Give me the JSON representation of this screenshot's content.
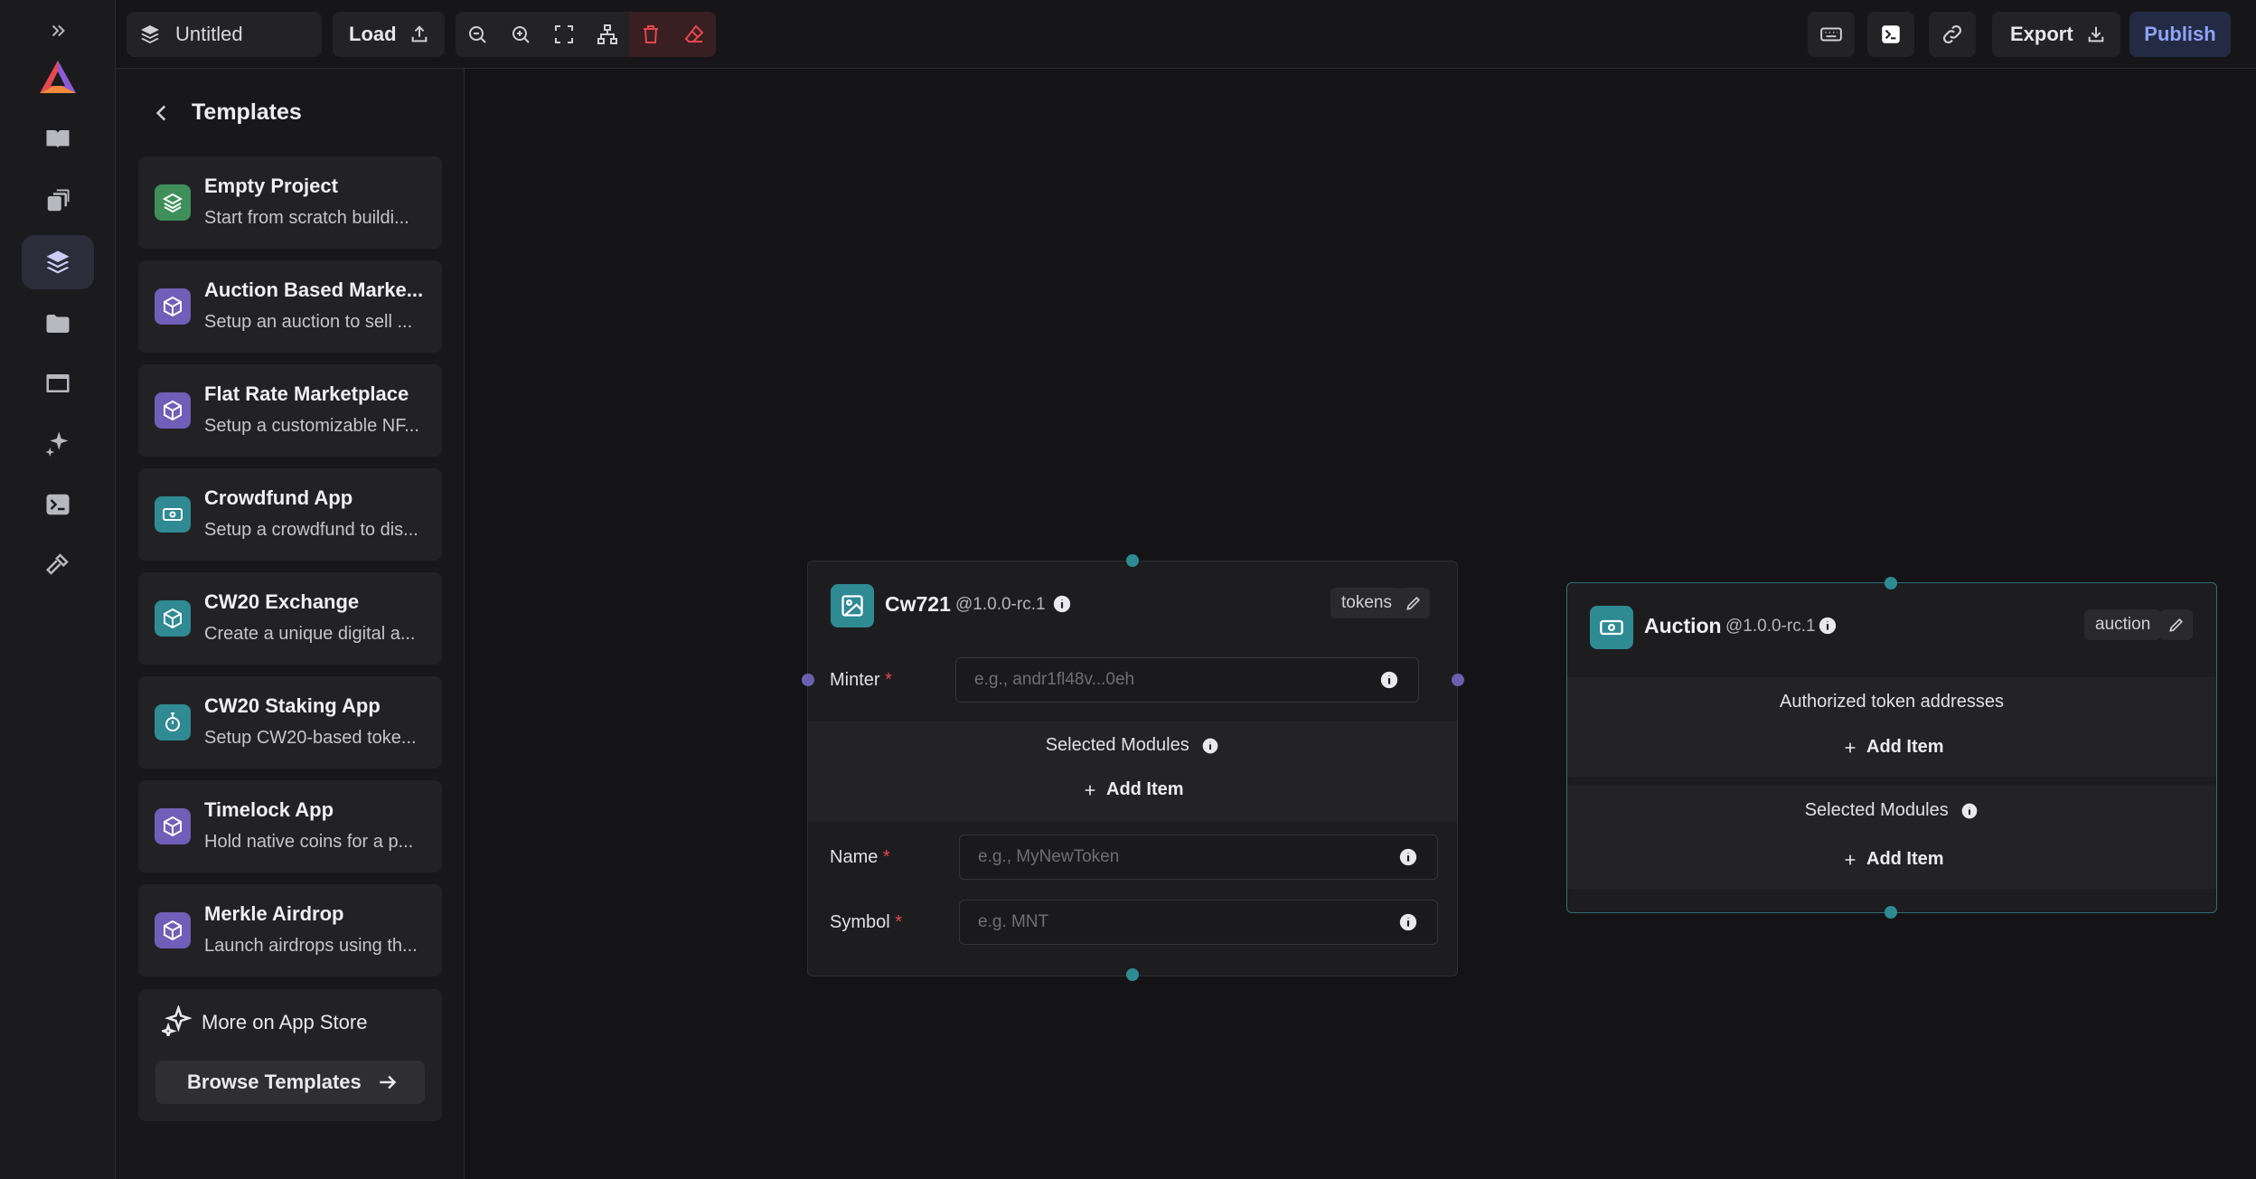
{
  "topbar": {
    "project_title": "Untitled",
    "load_label": "Load",
    "export_label": "Export",
    "publish_label": "Publish"
  },
  "panel": {
    "title": "Templates",
    "templates": [
      {
        "title": "Empty Project",
        "desc": "Start from scratch buildi...",
        "icon": "layers-icon",
        "color": "#3f8f5a"
      },
      {
        "title": "Auction Based Marke...",
        "desc": "Setup an auction to sell ...",
        "icon": "cube-icon",
        "color": "#6f5fb8"
      },
      {
        "title": "Flat Rate Marketplace",
        "desc": "Setup a customizable NF...",
        "icon": "cube-icon",
        "color": "#6f5fb8"
      },
      {
        "title": "Crowdfund App",
        "desc": "Setup a crowdfund to dis...",
        "icon": "banknote-icon",
        "color": "#2f8a93"
      },
      {
        "title": "CW20 Exchange",
        "desc": "Create a unique digital a...",
        "icon": "cube-icon",
        "color": "#2f8a93"
      },
      {
        "title": "CW20 Staking App",
        "desc": "Setup CW20-based toke...",
        "icon": "timer-icon",
        "color": "#2f8a93"
      },
      {
        "title": "Timelock App",
        "desc": "Hold native coins for a p...",
        "icon": "cube-icon",
        "color": "#6f5fb8"
      },
      {
        "title": "Merkle Airdrop",
        "desc": "Launch airdrops using th...",
        "icon": "cube-icon",
        "color": "#6f5fb8"
      }
    ],
    "store_label": "More on App Store",
    "browse_label": "Browse Templates"
  },
  "cw721": {
    "title": "Cw721",
    "version": "@1.0.0-rc.1",
    "tag": "tokens",
    "minter_label": "Minter",
    "minter_placeholder": "e.g., andr1fl48v...0eh",
    "modules_label": "Selected Modules",
    "add_item": "Add Item",
    "name_label": "Name",
    "name_placeholder": "e.g., MyNewToken",
    "symbol_label": "Symbol",
    "symbol_placeholder": "e.g. MNT"
  },
  "auction": {
    "title": "Auction",
    "version": "@1.0.0-rc.1",
    "tag": "auction",
    "tokens_label": "Authorized token addresses",
    "add_item": "Add Item",
    "modules_label": "Selected Modules",
    "add_item_2": "Add Item"
  },
  "colors": {
    "accent": "#2e8a93",
    "purple": "#6f5fb8",
    "green": "#3f8f5a",
    "danger": "#e5484d",
    "publish": "#8fa3f5"
  }
}
